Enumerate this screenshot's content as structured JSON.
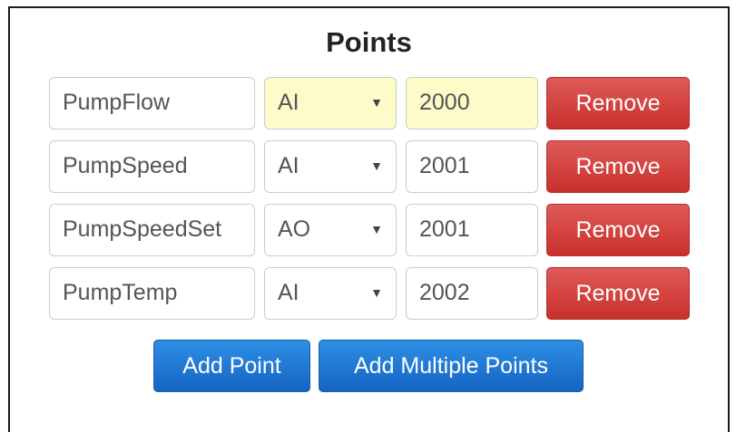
{
  "title": "Points",
  "points": [
    {
      "name": "PumpFlow",
      "type": "AI",
      "port": "2000",
      "remove_label": "Remove"
    },
    {
      "name": "PumpSpeed",
      "type": "AI",
      "port": "2001",
      "remove_label": "Remove"
    },
    {
      "name": "PumpSpeedSet",
      "type": "AO",
      "port": "2001",
      "remove_label": "Remove"
    },
    {
      "name": "PumpTemp",
      "type": "AI",
      "port": "2002",
      "remove_label": "Remove"
    }
  ],
  "select_caret": "▼",
  "actions": {
    "add_point_label": "Add Point",
    "add_multiple_label": "Add Multiple Points"
  },
  "colors": {
    "highlight": "#fdfbc8",
    "remove_button": "#c9302c",
    "primary_button": "#1664c4"
  }
}
